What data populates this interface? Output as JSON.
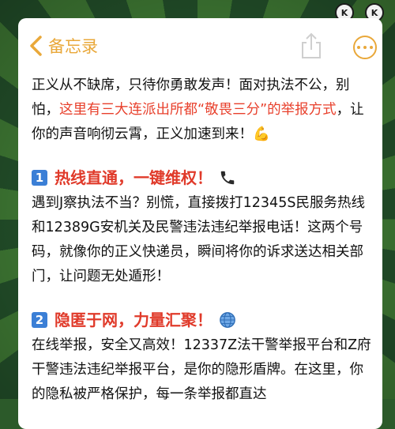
{
  "navbar": {
    "back_label": "备忘录",
    "accent": "#e9a83a"
  },
  "icons": {
    "back": "chevron-left-icon",
    "share": "share-icon",
    "more": "more-icon",
    "phone": "phone-icon",
    "globe": "globe-icon",
    "muscle": "flexed-biceps-icon"
  },
  "intro": {
    "text_a": "正义从不缺席，只待你勇敢发声！面对执法不公，别怕，",
    "highlight": "这里有三大连派出所都“敬畏三分”的举报方式",
    "text_b": "，让你的声音响彻云霄，正义加速到来！",
    "emoji": "💪"
  },
  "section1": {
    "number": "1",
    "title": "热线直通，一键维权！",
    "body": "遇到J察执法不当？别慌，直接拨打12345S民服务热线和12389G安机关及民警违法违纪举报电话！这两个号码，就像你的正义快递员，瞬间将你的诉求送达相关部门，让问题无处遁形！"
  },
  "section2": {
    "number": "2",
    "title": "隐匿于网，力量汇聚！",
    "body": "在线举报，安全又高效！12337Z法干警举报平台和Z府干警违法违纪举报平台，是你的隐形盾牌。在这里，你的隐私被严格保护，每一条举报都直达"
  },
  "colors": {
    "highlight": "#e8402c",
    "section_title": "#e03a2a",
    "number_badge": "#3b7fd6"
  }
}
